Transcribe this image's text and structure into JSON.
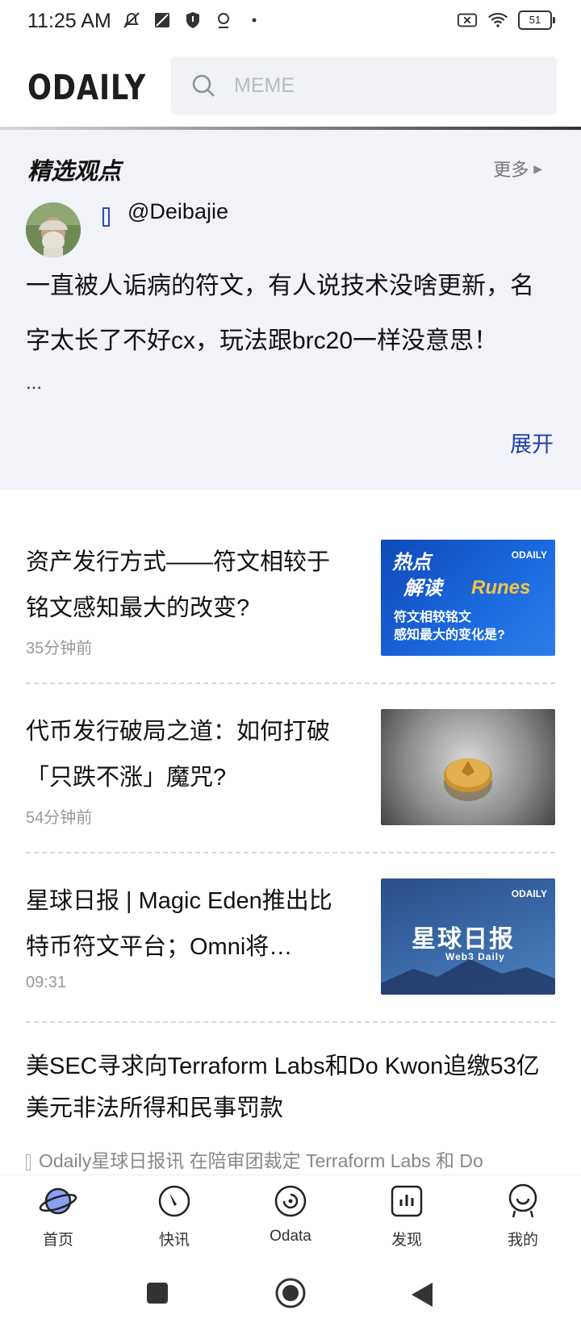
{
  "status_bar": {
    "time": "11:25 AM",
    "battery": "51"
  },
  "header": {
    "logo": "ODAILY",
    "search_placeholder": "MEME"
  },
  "featured": {
    "title": "精选观点",
    "more_label": "更多",
    "author": "@Deibajie",
    "quote": "一直被人诟病的符文，有人说技术没啥更新，名字太长了不好cx，玩法跟brc20一样没意思！",
    "ellipsis": "...",
    "expand_label": "展开"
  },
  "articles": [
    {
      "title": "资产发行方式——符文相较于铭文感知最大的改变?",
      "time": "35分钟前",
      "thumb": {
        "line1": "热点",
        "line2": "解读",
        "word": "Runes",
        "sub1": "符文相较铭文",
        "sub2": "感知最大的变化是?",
        "brand": "ODAILY"
      }
    },
    {
      "title": "代币发行破局之道：如何打破「只跌不涨」魔咒?",
      "time": "54分钟前"
    },
    {
      "title": "星球日报 | Magic Eden推出比特币符文平台；Omni将…",
      "time": "09:31",
      "thumb": {
        "main": "星球日报",
        "sub": "Web3 Daily",
        "brand": "ODAILY"
      }
    }
  ],
  "news": {
    "title": "美SEC寻求向Terraform Labs和Do Kwon追缴53亿美元非法所得和民事罚款",
    "snippet": "Odaily星球日报讯 在陪审团裁定 Terraform Labs 和 Do"
  },
  "bottom_nav": [
    {
      "label": "首页",
      "icon": "planet-icon"
    },
    {
      "label": "快讯",
      "icon": "compass-icon"
    },
    {
      "label": "Odata",
      "icon": "odata-icon"
    },
    {
      "label": "发现",
      "icon": "chart-icon"
    },
    {
      "label": "我的",
      "icon": "profile-icon"
    }
  ],
  "colors": {
    "accent": "#1f3fae",
    "featured_bg": "#f1f3f9"
  }
}
